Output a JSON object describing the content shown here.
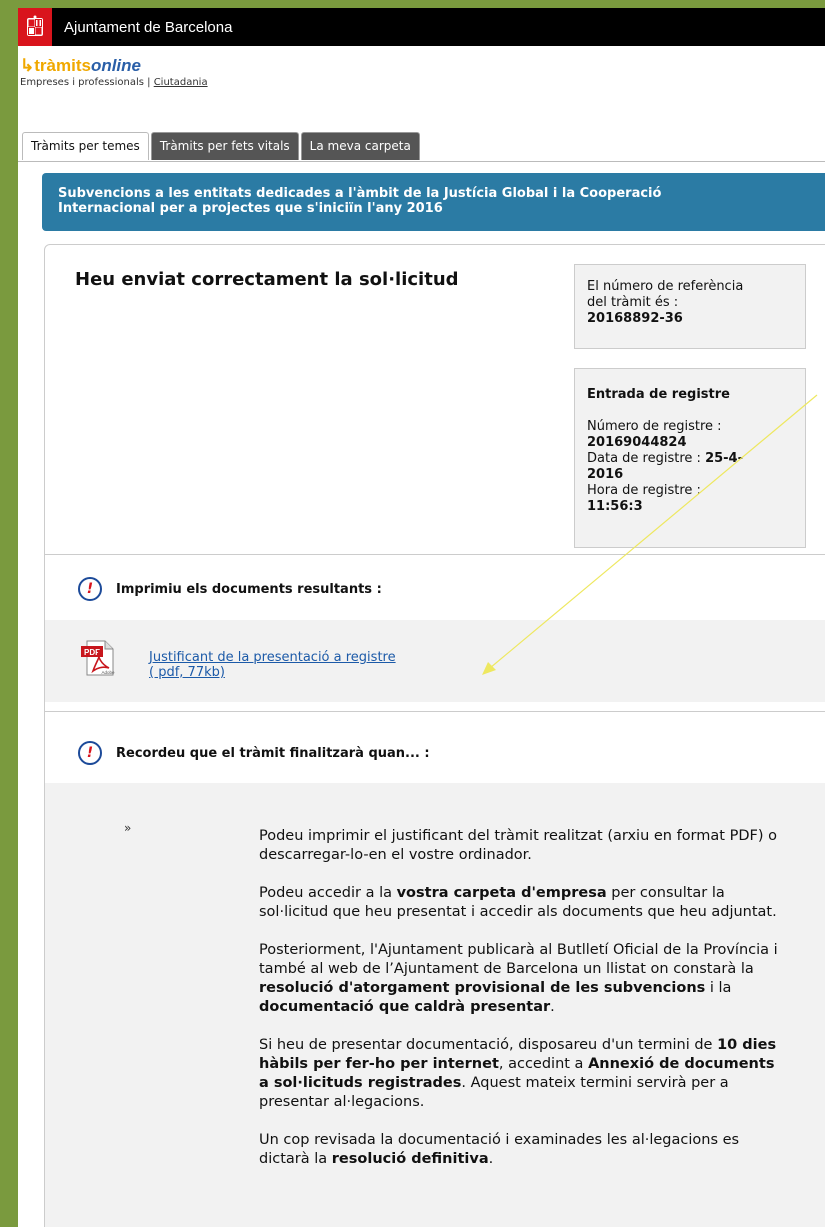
{
  "header": {
    "org_title": "Ajuntament de Barcelona"
  },
  "brand": {
    "logo_part1": "tràmits",
    "logo_part2": "online",
    "sub_label": "Empreses i professionals |",
    "sub_link": "Ciutadania"
  },
  "tabs": [
    {
      "label": "Tràmits per temes"
    },
    {
      "label": "Tràmits per fets vitals"
    },
    {
      "label": "La meva carpeta"
    }
  ],
  "banner": {
    "line1": "Subvencions a les entitats dedicades a l'àmbit de la Justícia Global i la Cooperació",
    "line2": "Internacional per a projectes que s'iniciïn l'any 2016"
  },
  "main": {
    "heading": "Heu enviat correctament la sol·licitud",
    "reference": {
      "line1": "El número de referència",
      "line2": "del tràmit és :",
      "number": "20168892-36"
    },
    "registry": {
      "title": "Entrada de registre",
      "number_label": "Número de registre :",
      "number": "20169044824",
      "date_label": "Data de registre :",
      "date_part1": "25-4-",
      "date_part2": "2016",
      "time_label": "Hora de registre :",
      "time": "11:56:3"
    },
    "print_section": {
      "title": "Imprimiu els documents resultants :",
      "doc_link_line1": "Justificant de la presentació a registre",
      "doc_link_line2": "( pdf, 77kb)"
    },
    "remember_section": {
      "title": "Recordeu que el tràmit finalitzarà quan... :",
      "bullet": "»",
      "p1": "Podeu imprimir el justificant del tràmit realitzat (arxiu en format PDF) o descarregar-lo-en el vostre ordinador.",
      "p2_a": "Podeu accedir a la ",
      "p2_b": "vostra carpeta d'empresa",
      "p2_c": " per consultar la sol·licitud que heu presentat i accedir als documents que heu adjuntat.",
      "p3_a": "Posteriorment, l'Ajuntament publicarà al Butlletí Oficial de la Província i també al web de l’Ajuntament de Barcelona un llistat on constarà la ",
      "p3_b": "resolució d'atorgament provisional de les subvencions",
      "p3_c": " i la ",
      "p3_d": "documentació que caldrà presentar",
      "p3_e": ".",
      "p4_a": "Si heu de presentar documentació, disposareu d'un termini de ",
      "p4_b": "10 dies hàbils per fer-ho per internet",
      "p4_c": ", accedint a ",
      "p4_d": "Annexió de documents a sol·licituds registrades",
      "p4_e": ". Aquest mateix termini servirà per a presentar al·legacions.",
      "p5_a": "Un cop revisada la documentació i examinades les al·legacions es dictarà la ",
      "p5_b": "resolució definitiva",
      "p5_c": "."
    }
  },
  "icons": {
    "pdf_label": "PDF",
    "pdf_brand": "Adobe"
  },
  "colors": {
    "banner": "#2b7ba4",
    "topbar": "#000000",
    "link": "#1c5aa8",
    "alert": "#d9141c"
  }
}
